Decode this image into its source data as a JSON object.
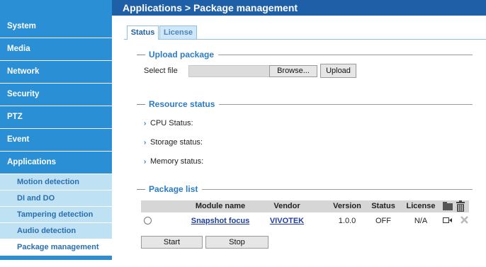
{
  "header": {
    "title": "Applications > Package management"
  },
  "sidebar": {
    "items": [
      {
        "label": "System"
      },
      {
        "label": "Media"
      },
      {
        "label": "Network"
      },
      {
        "label": "Security"
      },
      {
        "label": "PTZ"
      },
      {
        "label": "Event"
      },
      {
        "label": "Applications"
      }
    ],
    "subitems": [
      {
        "label": "Motion detection"
      },
      {
        "label": "DI and DO"
      },
      {
        "label": "Tampering detection"
      },
      {
        "label": "Audio detection"
      },
      {
        "label": "Package management",
        "active": true
      }
    ]
  },
  "tabs": [
    {
      "label": "Status",
      "active": true
    },
    {
      "label": "License",
      "active": false
    }
  ],
  "upload": {
    "section_title": "Upload package",
    "select_file_label": "Select file",
    "file_value": "",
    "browse_label": "Browse...",
    "upload_label": "Upload"
  },
  "resource": {
    "section_title": "Resource status",
    "rows": [
      {
        "label": "CPU Status:"
      },
      {
        "label": "Storage status:"
      },
      {
        "label": "Memory status:"
      }
    ]
  },
  "packages": {
    "section_title": "Package list",
    "columns": [
      "Module name",
      "Vendor",
      "Version",
      "Status",
      "License"
    ],
    "rows": [
      {
        "module": "Snapshot focus",
        "vendor": "VIVOTEK",
        "version": "1.0.0",
        "status": "OFF",
        "license": "N/A"
      }
    ],
    "start_label": "Start",
    "stop_label": "Stop"
  },
  "icons": {
    "folder": "folder-icon",
    "trash": "trash-icon",
    "camera": "camera-icon",
    "remove": "remove-icon"
  },
  "colors": {
    "header": "#1f5fa8",
    "sidebar": "#2a8fd4",
    "submenu": "#bfe1f4",
    "section_title": "#2a7cc7"
  }
}
